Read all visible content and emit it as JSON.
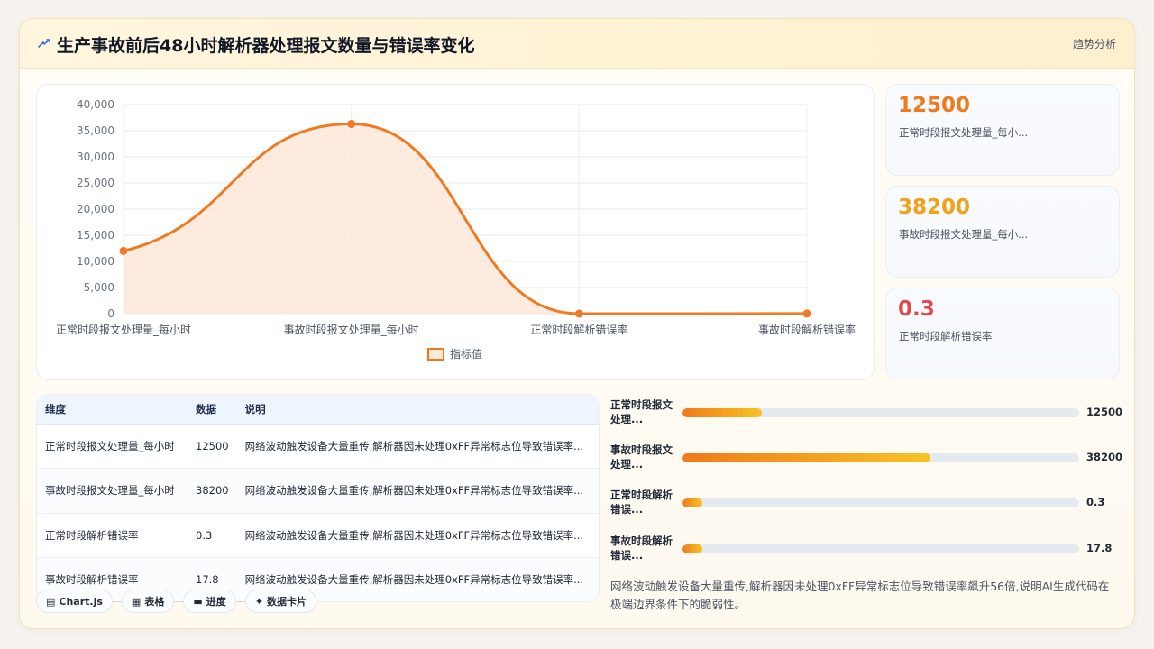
{
  "header": {
    "title": "生产事故前后48小时解析器处理报文数量与错误率变化",
    "tag": "趋势分析",
    "icon": "bolt-icon"
  },
  "chart_data": {
    "type": "line",
    "categories": [
      "正常时段报文处理量_每小时",
      "事故时段报文处理量_每小时",
      "正常时段解析错误率",
      "事故时段解析错误率"
    ],
    "series": [
      {
        "name": "指标值",
        "values": [
          12000,
          36300,
          0.3,
          17.8
        ]
      }
    ],
    "y_ticks": [
      "40,000",
      "35,000",
      "30,000",
      "25,000",
      "20,000",
      "15,000",
      "10,000",
      "5,000",
      "0"
    ],
    "ylim": [
      0,
      40000
    ],
    "grid": true,
    "legend": "bottom",
    "color": "#ee7a22",
    "fill": "#fde8d9"
  },
  "kpis": [
    {
      "value": "12500",
      "label": "正常时段报文处理量_每小...",
      "color": "#ef7b1c"
    },
    {
      "value": "38200",
      "label": "事故时段报文处理量_每小...",
      "color": "#f0a21a"
    },
    {
      "value": "0.3",
      "label": "正常时段解析错误率",
      "color": "#e0474c"
    }
  ],
  "table": {
    "headers": [
      "维度",
      "数据",
      "说明"
    ],
    "rows": [
      {
        "dim": "正常时段报文处理量_每小时",
        "val": "12500",
        "desc": "网络波动触发设备大量重传,解析器因未处理0xFF异常标志位导致错误率..."
      },
      {
        "dim": "事故时段报文处理量_每小时",
        "val": "38200",
        "desc": "网络波动触发设备大量重传,解析器因未处理0xFF异常标志位导致错误率..."
      },
      {
        "dim": "正常时段解析错误率",
        "val": "0.3",
        "desc": "网络波动触发设备大量重传,解析器因未处理0xFF异常标志位导致错误率..."
      },
      {
        "dim": "事故时段解析错误率",
        "val": "17.8",
        "desc": "网络波动触发设备大量重传,解析器因未处理0xFF异常标志位导致错误率..."
      }
    ]
  },
  "chips": [
    {
      "icon": "▤",
      "label": "Chart.js"
    },
    {
      "icon": "▦",
      "label": "表格"
    },
    {
      "icon": "▬",
      "label": "进度"
    },
    {
      "icon": "✦",
      "label": "数据卡片"
    }
  ],
  "progress": [
    {
      "label": "正常时段报文处理...",
      "value": "12500",
      "pct": 0.2
    },
    {
      "label": "事故时段报文处理...",
      "value": "38200",
      "pct": 0.625
    },
    {
      "label": "正常时段解析错误...",
      "value": "0.3",
      "pct": 0.05
    },
    {
      "label": "事故时段解析错误...",
      "value": "17.8",
      "pct": 0.05
    }
  ],
  "insight": "网络波动触发设备大量重传,解析器因未处理0xFF异常标志位导致错误率飙升56倍,说明AI生成代码在极端边界条件下的脆弱性。"
}
